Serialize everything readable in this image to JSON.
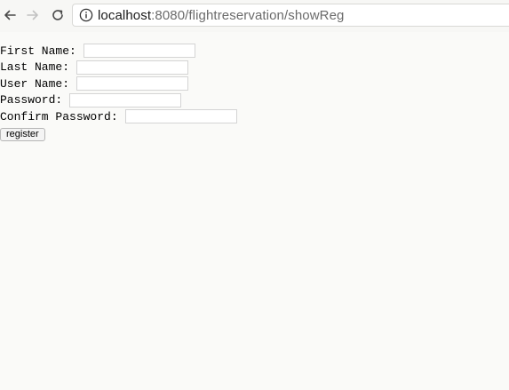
{
  "browser": {
    "url_host": "localhost",
    "url_rest": ":8080/flightreservation/showReg"
  },
  "form": {
    "first_name_label": "First Name:",
    "last_name_label": "Last Name:",
    "user_name_label": "User Name:",
    "password_label": "Password:",
    "confirm_password_label": "Confirm Password:",
    "register_label": "register",
    "first_name_value": "",
    "last_name_value": "",
    "user_name_value": "",
    "password_value": "",
    "confirm_password_value": ""
  },
  "icons": {
    "back": "back-arrow-icon",
    "forward": "forward-arrow-icon",
    "reload": "reload-icon",
    "info": "info-icon"
  },
  "colors": {
    "page_background": "#fafaf8",
    "field_border": "#d4d4d4"
  }
}
